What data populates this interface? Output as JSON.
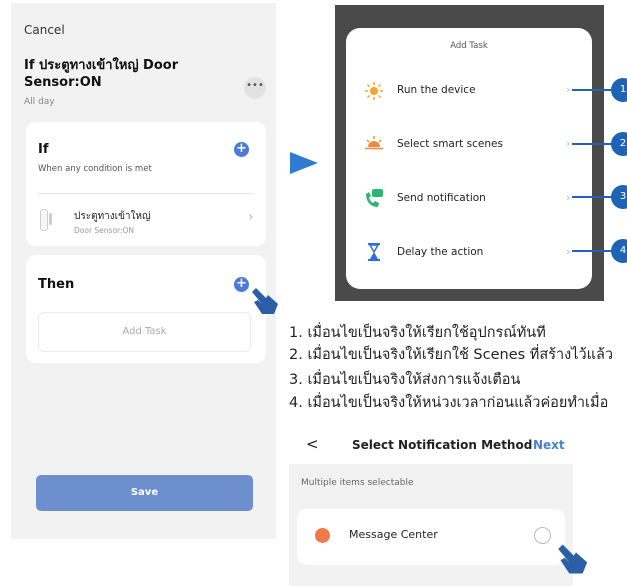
{
  "left_screen": {
    "cancel": "Cancel",
    "rule_title": "If ประตูทางเข้าใหญ่ Door Sensor:ON",
    "schedule": "All day",
    "more": "•••",
    "if_card": {
      "heading": "If",
      "subtitle": "When any condition is met",
      "add_icon": "+",
      "device_name": "ประตูทางเข้าใหญ่",
      "device_status": "Door Sensor:ON",
      "chevron": "›"
    },
    "then_card": {
      "heading": "Then",
      "add_icon": "+",
      "add_task": "Add Task"
    },
    "save": "Save"
  },
  "add_task_panel": {
    "title": "Add Task",
    "options": [
      {
        "label": "Run the device",
        "icon": "sun-icon",
        "number": "1"
      },
      {
        "label": "Select smart scenes",
        "icon": "sunrise-icon",
        "number": "2"
      },
      {
        "label": "Send notification",
        "icon": "phone-message-icon",
        "number": "3"
      },
      {
        "label": "Delay the action",
        "icon": "hourglass-icon",
        "number": "4"
      }
    ],
    "chevron": "›"
  },
  "descriptions": [
    "1. เมื่อนไขเป็นจริงให้เรียกใช้อุปกรณ์ทันที",
    "2. เมื่อนไขเป็นจริงให้เรียกใช้ Scenes ที่สร้างไว้แล้ว",
    "3. เมื่อนไขเป็นจริงให้ส่งการแจ้งเตือน",
    "4. เมื่อนไขเป็นจริงให้หน่วงเวลาก่อนแล้วค่อยทำเมื่อ"
  ],
  "notification_screen": {
    "back": "<",
    "title": "Select Notification Method",
    "next": "Next",
    "hint": "Multiple items selectable",
    "item": "Message Center"
  },
  "colors": {
    "accent": "#4b7bd6",
    "callout_blue": "#1f63b4",
    "save_button": "#6d8fcd",
    "overlay": "#4a4a4a"
  }
}
